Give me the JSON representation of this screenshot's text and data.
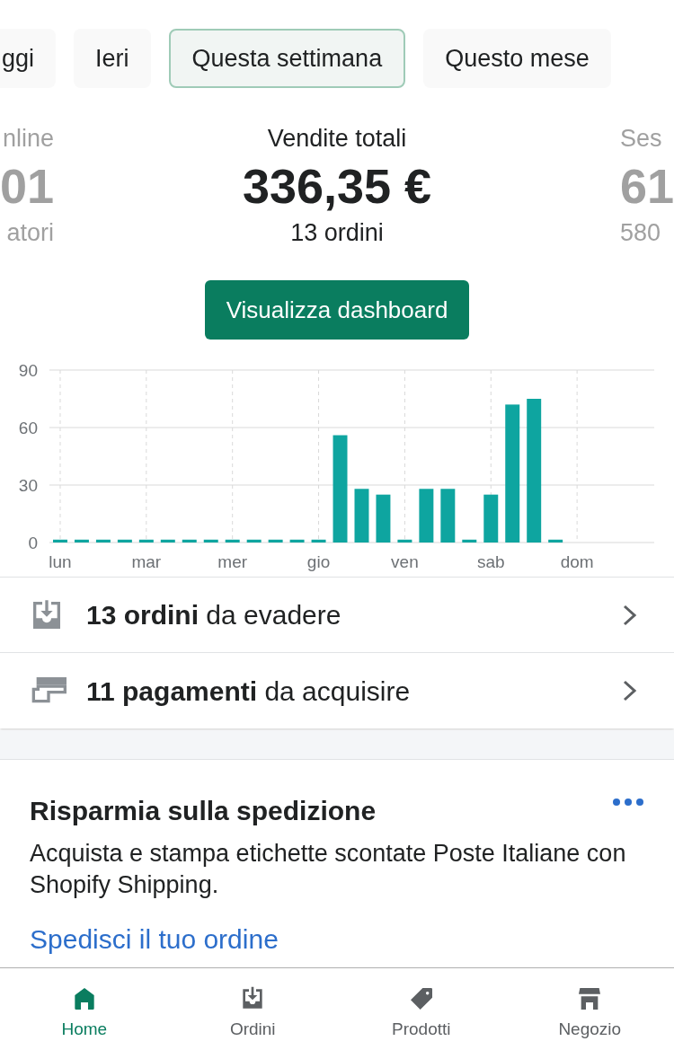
{
  "periods": [
    {
      "label": "ggi",
      "selected": false
    },
    {
      "label": "Ieri",
      "selected": false
    },
    {
      "label": "Questa settimana",
      "selected": true
    },
    {
      "label": "Questo mese",
      "selected": false
    }
  ],
  "stats": [
    {
      "title": "nline",
      "value": "01",
      "sub": "atori",
      "selected": false
    },
    {
      "title": "Vendite totali",
      "value": "336,35 €",
      "sub": "13 ordini",
      "selected": true
    },
    {
      "title": "Ses",
      "value": "61",
      "sub": "580",
      "selected": false
    }
  ],
  "dashboard_button": "Visualizza dashboard",
  "chart_data": {
    "type": "bar",
    "categories": [
      "lun",
      null,
      null,
      null,
      "mar",
      null,
      null,
      null,
      "mer",
      null,
      null,
      null,
      "gio",
      null,
      null,
      null,
      "ven",
      null,
      null,
      null,
      "sab",
      null,
      null,
      null,
      "dom",
      null,
      null,
      null
    ],
    "series": [
      {
        "color": "#0ea5a0",
        "values": [
          1.5,
          1.5,
          1.5,
          1.5,
          1.5,
          1.5,
          1.5,
          1.5,
          1.5,
          1.5,
          1.5,
          1.5,
          1.5,
          56,
          28,
          25,
          1.5,
          28,
          28,
          1.5,
          25,
          72,
          75,
          1.5,
          0,
          0,
          0,
          0
        ]
      }
    ],
    "ylim": [
      0,
      90
    ],
    "yticks": [
      0,
      30,
      60,
      90
    ],
    "grid": true
  },
  "tasks": [
    {
      "kind": "orders",
      "text": "**13 ordini** da evadere"
    },
    {
      "kind": "payments",
      "text": "**11 pagamenti** da acquisire"
    }
  ],
  "card": {
    "title": "Risparmia sulla spedizione",
    "body": "Acquista e stampa etichette scontate Poste Italiane con Shopify Shipping.",
    "link": "Spedisci il tuo ordine"
  },
  "nav": [
    {
      "kind": "home",
      "label": "Home",
      "selected": true
    },
    {
      "kind": "orders",
      "label": "Ordini",
      "selected": false
    },
    {
      "kind": "tag",
      "label": "Prodotti",
      "selected": false
    },
    {
      "kind": "store",
      "label": "Negozio",
      "selected": false
    }
  ]
}
